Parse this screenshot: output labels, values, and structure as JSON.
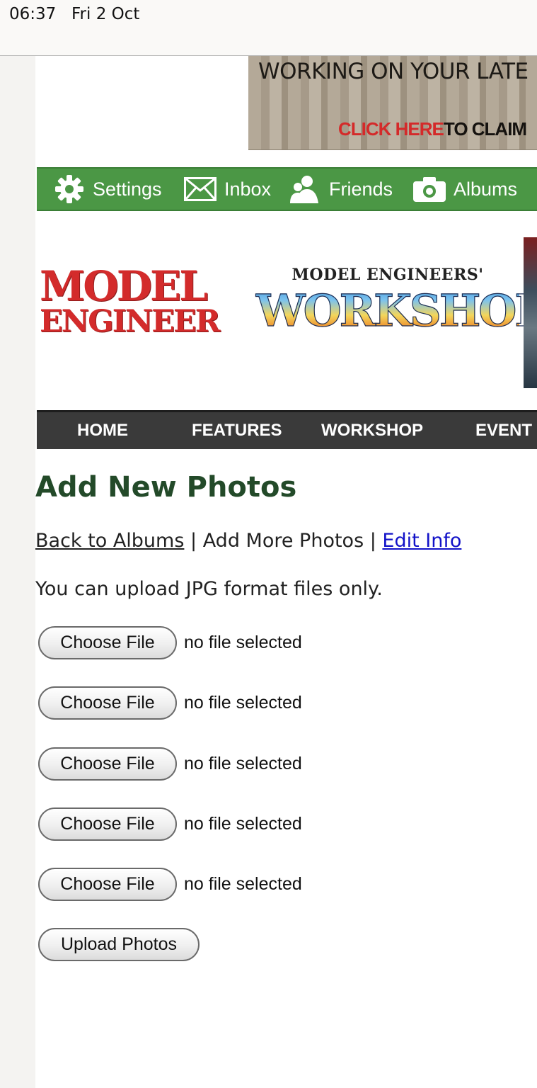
{
  "status_bar": {
    "time": "06:37",
    "date": "Fri 2 Oct"
  },
  "ad_banner": {
    "headline": "WORKING ON YOUR LATE",
    "cta_red": "CLICK HERE",
    "cta_dark": "TO CLAIM"
  },
  "user_nav": {
    "items": [
      {
        "label": "Settings",
        "icon": "gear-icon"
      },
      {
        "label": "Inbox",
        "icon": "envelope-icon"
      },
      {
        "label": "Friends",
        "icon": "friends-icon"
      },
      {
        "label": "Albums",
        "icon": "camera-icon"
      }
    ]
  },
  "logos": {
    "model_engineer_line1": "MODEL",
    "model_engineer_line2": "ENGINEER",
    "workshop_top": "MODEL ENGINEERS'",
    "workshop_main": "WORKSHOP"
  },
  "main_nav": {
    "items": [
      "HOME",
      "FEATURES",
      "WORKSHOP",
      "EVENT"
    ]
  },
  "content": {
    "title": "Add New Photos",
    "links": {
      "back": "Back to Albums",
      "sep": " | ",
      "add_more": "Add More Photos",
      "edit": "Edit Info"
    },
    "upload_note": "You can upload JPG format files only.",
    "choose_file_label": "Choose File",
    "no_file_text": "no file selected",
    "upload_label": "Upload Photos"
  },
  "colors": {
    "nav_green": "#4b9745",
    "title_green": "#234a29",
    "main_nav_bg": "#3a3a3a",
    "link_blue": "#1212c8"
  }
}
